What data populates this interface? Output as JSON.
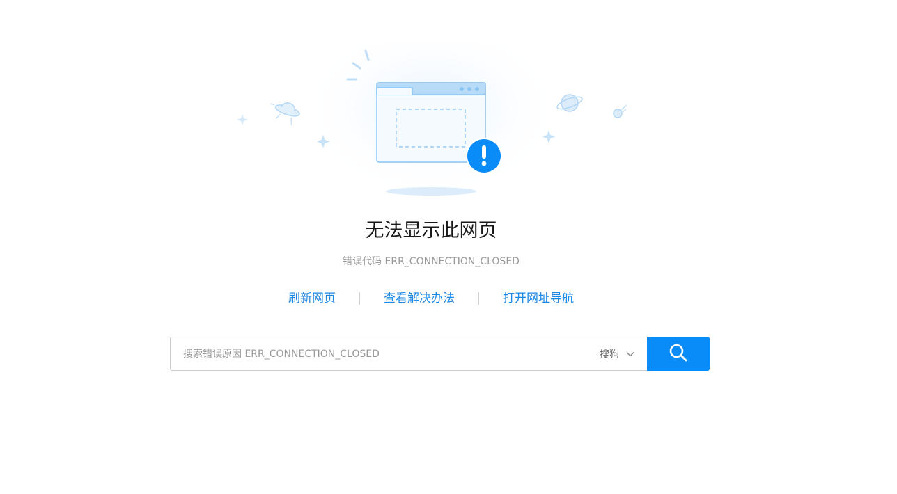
{
  "main": {
    "title": "无法显示此网页",
    "error_code": "错误代码 ERR_CONNECTION_CLOSED"
  },
  "actions": {
    "refresh_label": "刷新网页",
    "solutions_label": "查看解决办法",
    "nav_label": "打开网址导航"
  },
  "search": {
    "placeholder": "搜索错误原因 ERR_CONNECTION_CLOSED",
    "value": "",
    "engine": "搜狗"
  },
  "colors": {
    "accent": "#0a8cf8",
    "link": "#1e88e5",
    "illustration_light": "#cfe6fb",
    "illustration_stroke": "#8cc4f2"
  }
}
